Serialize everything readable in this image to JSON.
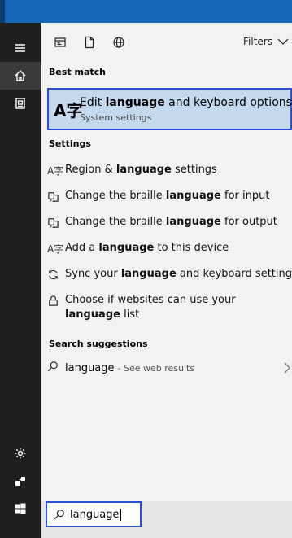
{
  "topbar": {
    "icons": [
      "document-icon",
      "file-icon",
      "globe-icon"
    ],
    "filters_label": "Filters"
  },
  "best_match": {
    "section_label": "Best match",
    "title_prefix": "Edit ",
    "title_bold": "language",
    "title_suffix": " and keyboard options",
    "subtitle": "System settings",
    "icon_glyph": "A字"
  },
  "settings": {
    "section_label": "Settings",
    "items": [
      {
        "icon": "language-icon",
        "prefix": "Region & ",
        "bold": "language",
        "suffix": " settings"
      },
      {
        "icon": "braille-icon",
        "prefix": "Change the braille ",
        "bold": "language",
        "suffix": " for input"
      },
      {
        "icon": "braille-icon",
        "prefix": "Change the braille ",
        "bold": "language",
        "suffix": " for output"
      },
      {
        "icon": "language-icon",
        "prefix": "Add a ",
        "bold": "language",
        "suffix": " to this device"
      },
      {
        "icon": "sync-icon",
        "prefix": "Sync your ",
        "bold": "language",
        "suffix": " and keyboard settings"
      },
      {
        "icon": "lock-icon",
        "prefix": "Choose if websites can use your ",
        "bold": "language",
        "suffix": " list"
      }
    ]
  },
  "suggestions": {
    "section_label": "Search suggestions",
    "term": "language",
    "hint": " - See web results"
  },
  "search": {
    "value": "language"
  },
  "colors": {
    "accent": "#2a4fd6",
    "titlebar": "#1466b8",
    "rail": "#1f1f1f",
    "best_bg": "#c5d9ee"
  }
}
